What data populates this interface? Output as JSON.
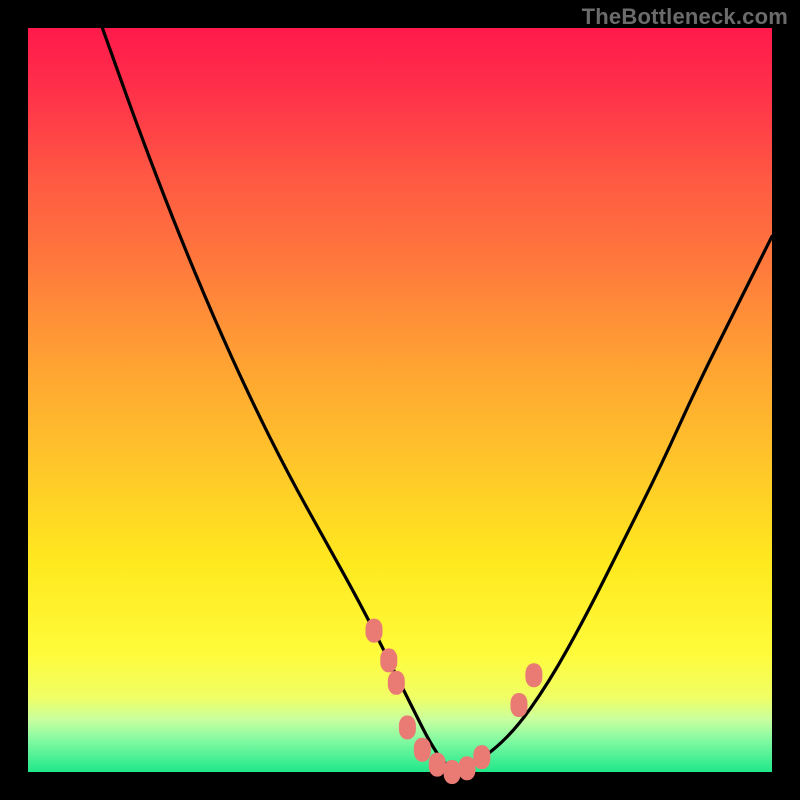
{
  "watermark": "TheBottleneck.com",
  "chart_data": {
    "type": "line",
    "title": "",
    "xlabel": "",
    "ylabel": "",
    "xlim": [
      0,
      100
    ],
    "ylim": [
      0,
      100
    ],
    "series": [
      {
        "name": "bottleneck-curve",
        "color": "#000000",
        "x": [
          10,
          15,
          20,
          25,
          30,
          35,
          40,
          45,
          50,
          52,
          54,
          56,
          58,
          60,
          65,
          70,
          75,
          80,
          85,
          90,
          95,
          100
        ],
        "values": [
          100,
          86,
          73,
          61,
          50,
          40,
          31,
          22,
          12,
          8,
          4,
          1,
          0,
          1,
          5,
          12,
          21,
          31,
          41,
          52,
          62,
          72
        ]
      }
    ],
    "markers": {
      "name": "highlight-nodes",
      "color": "#e97a74",
      "points": [
        {
          "x": 46.5,
          "y": 19
        },
        {
          "x": 48.5,
          "y": 15
        },
        {
          "x": 49.5,
          "y": 12
        },
        {
          "x": 51.0,
          "y": 6
        },
        {
          "x": 53.0,
          "y": 3
        },
        {
          "x": 55.0,
          "y": 1
        },
        {
          "x": 57.0,
          "y": 0
        },
        {
          "x": 59.0,
          "y": 0.5
        },
        {
          "x": 61.0,
          "y": 2
        },
        {
          "x": 66.0,
          "y": 9
        },
        {
          "x": 68.0,
          "y": 13
        }
      ]
    },
    "background_gradient": {
      "top": "#ff1a4b",
      "upper_mid": "#ffa233",
      "lower_mid": "#fffb3a",
      "bottom": "#1fe88a"
    }
  }
}
